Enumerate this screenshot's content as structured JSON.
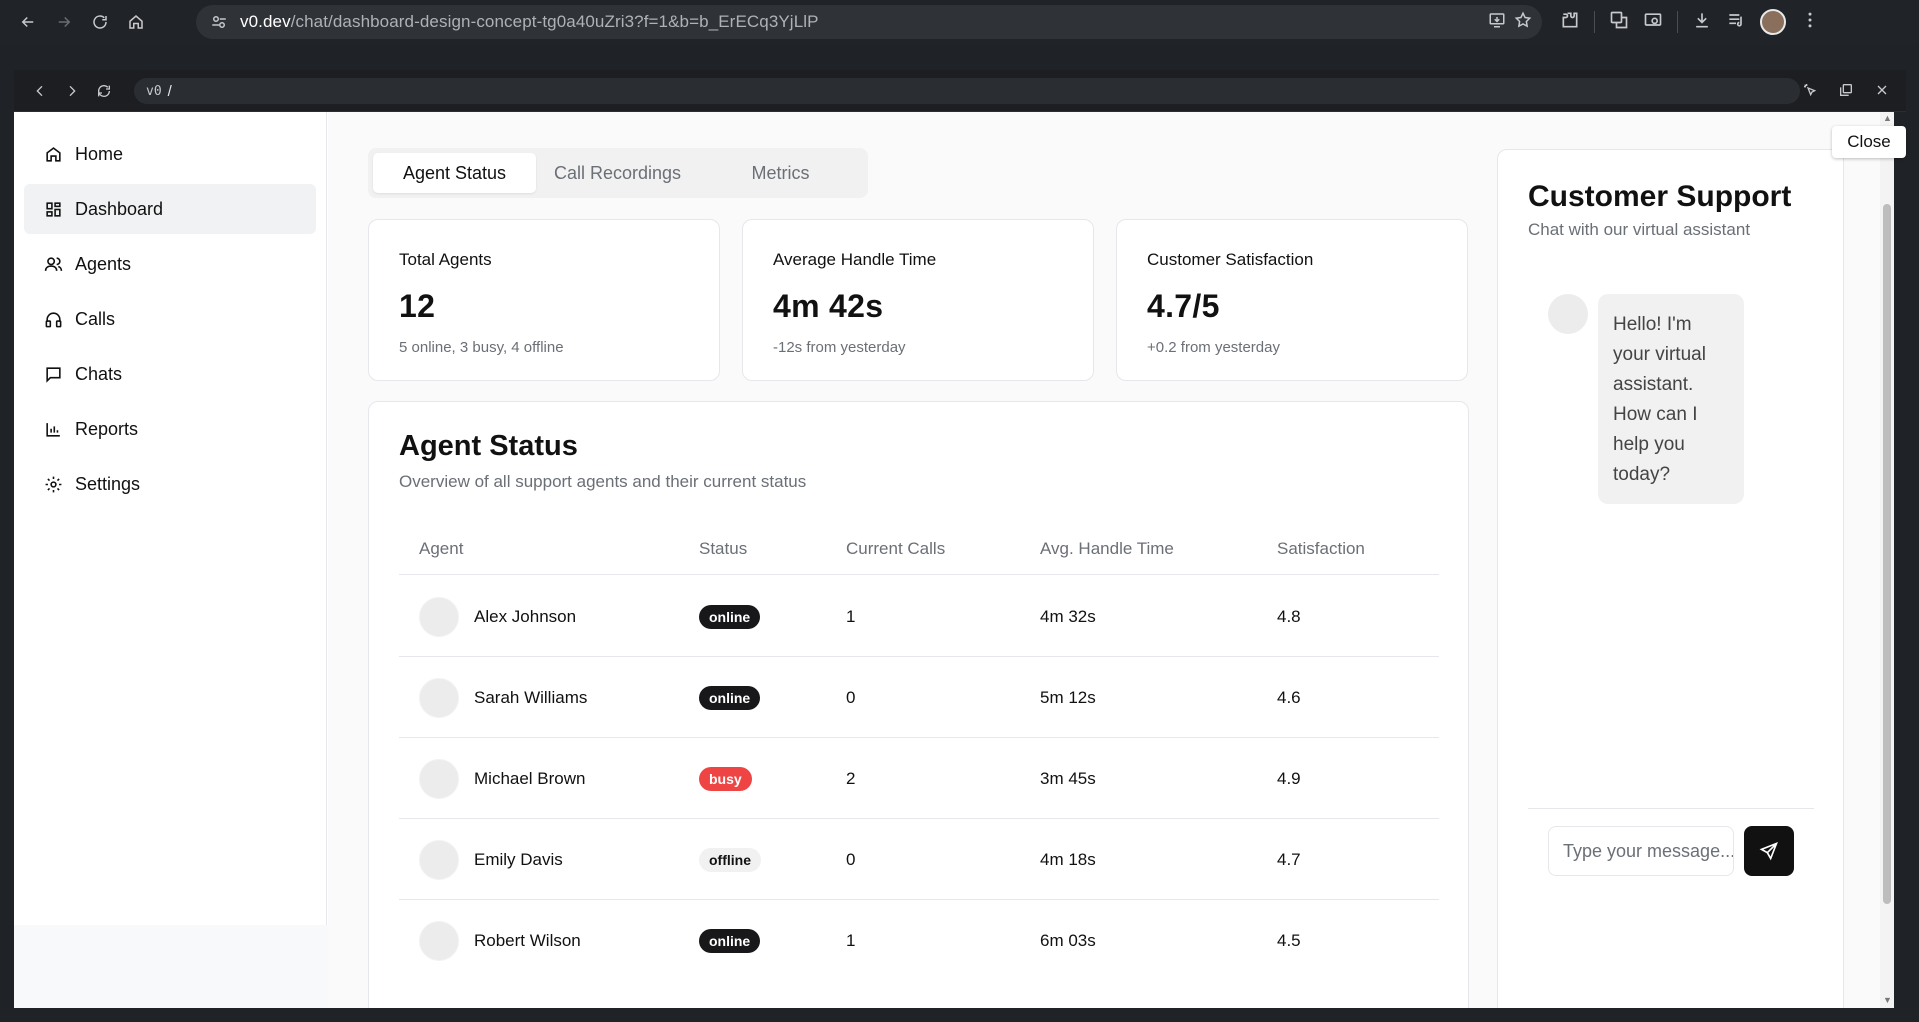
{
  "browser": {
    "url_host": "v0.dev",
    "url_path": "/chat/dashboard-design-concept-tg0a40uZri3?f=1&b=b_ErECq3YjLlP"
  },
  "preview": {
    "url_prefix": "v0",
    "url_path": "/",
    "close_tooltip": "Close"
  },
  "sidebar": {
    "items": [
      {
        "label": "Home"
      },
      {
        "label": "Dashboard"
      },
      {
        "label": "Agents"
      },
      {
        "label": "Calls"
      },
      {
        "label": "Chats"
      },
      {
        "label": "Reports"
      },
      {
        "label": "Settings"
      }
    ],
    "active": "Dashboard"
  },
  "tabs": [
    {
      "label": "Agent Status"
    },
    {
      "label": "Call Recordings"
    },
    {
      "label": "Metrics"
    }
  ],
  "stats": [
    {
      "title": "Total Agents",
      "value": "12",
      "sub": "5 online, 3 busy, 4 offline"
    },
    {
      "title": "Average Handle Time",
      "value": "4m 42s",
      "sub": "-12s from yesterday"
    },
    {
      "title": "Customer Satisfaction",
      "value": "4.7/5",
      "sub": "+0.2 from yesterday"
    }
  ],
  "table": {
    "title": "Agent Status",
    "subtitle": "Overview of all support agents and their current status",
    "headers": [
      "Agent",
      "Status",
      "Current Calls",
      "Avg. Handle Time",
      "Satisfaction"
    ],
    "rows": [
      {
        "name": "Alex Johnson",
        "status": "online",
        "calls": "1",
        "aht": "4m 32s",
        "sat": "4.8"
      },
      {
        "name": "Sarah Williams",
        "status": "online",
        "calls": "0",
        "aht": "5m 12s",
        "sat": "4.6"
      },
      {
        "name": "Michael Brown",
        "status": "busy",
        "calls": "2",
        "aht": "3m 45s",
        "sat": "4.9"
      },
      {
        "name": "Emily Davis",
        "status": "offline",
        "calls": "0",
        "aht": "4m 18s",
        "sat": "4.7"
      },
      {
        "name": "Robert Wilson",
        "status": "online",
        "calls": "1",
        "aht": "6m 03s",
        "sat": "4.5"
      }
    ]
  },
  "chat": {
    "title": "Customer Support",
    "subtitle": "Chat with our virtual assistant",
    "bot_message": "Hello! I'm your virtual assistant. How can I help you today?",
    "input_placeholder": "Type your message...",
    "input_value": ""
  },
  "colors": {
    "online": "#18181b",
    "busy": "#ef4444",
    "offline": "#f1f1f2"
  }
}
